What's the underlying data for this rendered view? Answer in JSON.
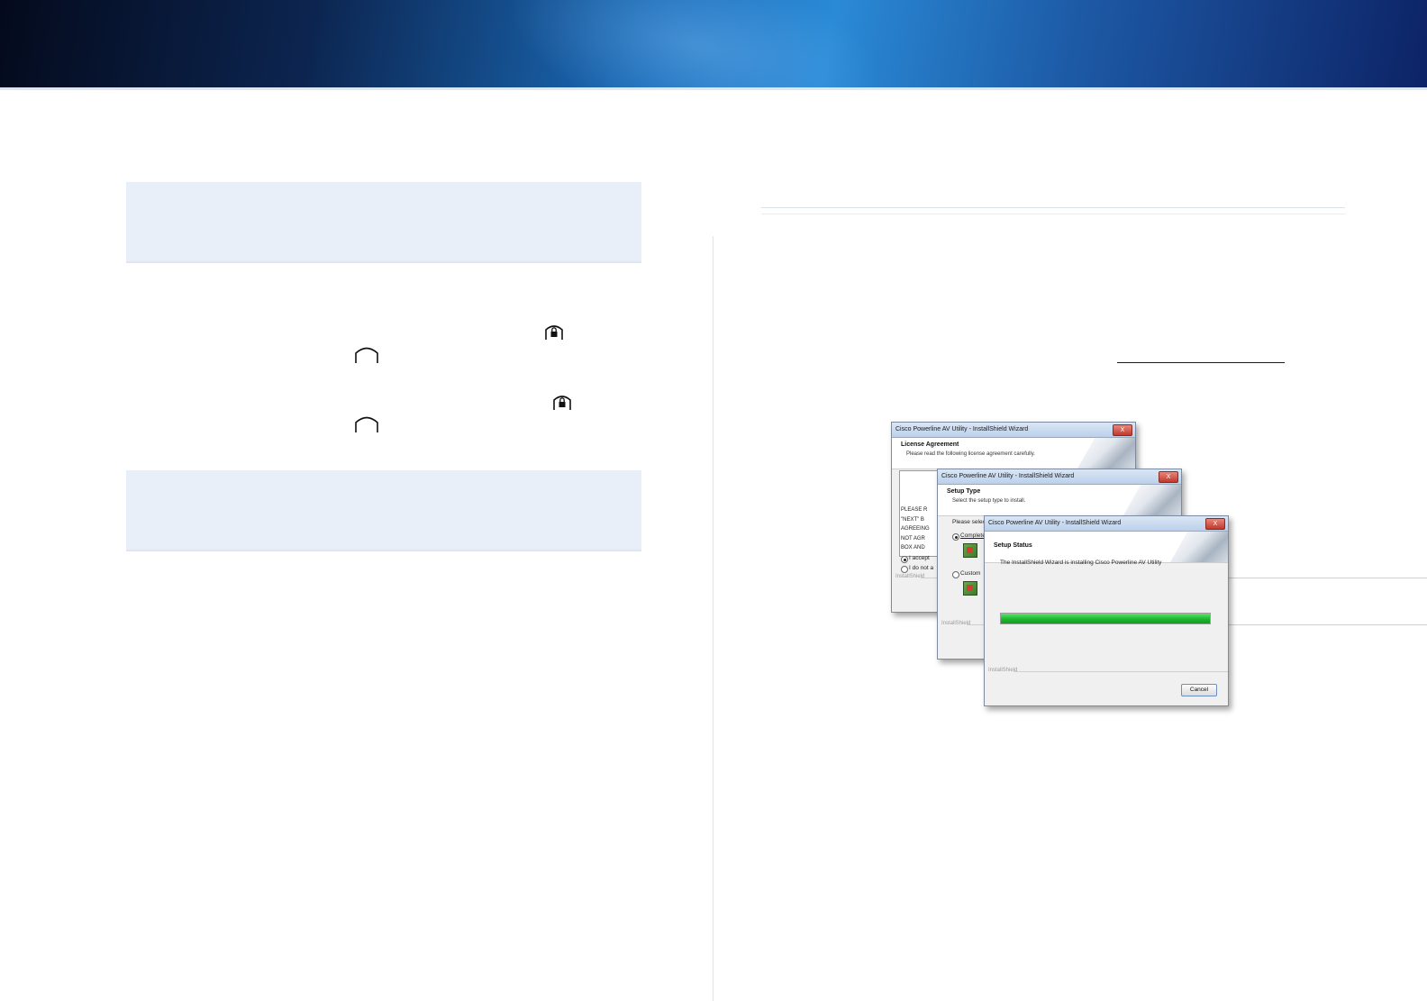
{
  "installer": {
    "window_title_1": "Cisco Powerline AV Utility - InstallShield Wizard",
    "window_title_2": "Cisco Powerline AV Utility - InstallShield Wizard",
    "window_title_3": "Cisco Powerline AV Utility - InstallShield Wizard",
    "close_label": "X",
    "license": {
      "title": "License Agreement",
      "subtitle": "Please read the following license agreement carefully.",
      "body_lines": [
        "PLEASE R",
        "\"NEXT\" B",
        "AGREEING",
        "NOT AGR",
        "BOX AND"
      ],
      "accept_option": "I accept",
      "decline_option": "I do not a",
      "brand": "InstallShield"
    },
    "setup_type": {
      "title": "Setup Type",
      "subtitle": "Select the setup type to install.",
      "prompt": "Please select",
      "complete_option": "Complete",
      "custom_option": "Custom",
      "brand": "InstallShield"
    },
    "setup_status": {
      "title": "Setup Status",
      "message": "The InstallShield Wizard is installing Cisco Powerline AV Utility",
      "progress": 1.0,
      "brand": "InstallShield",
      "cancel_label": "Cancel"
    }
  }
}
